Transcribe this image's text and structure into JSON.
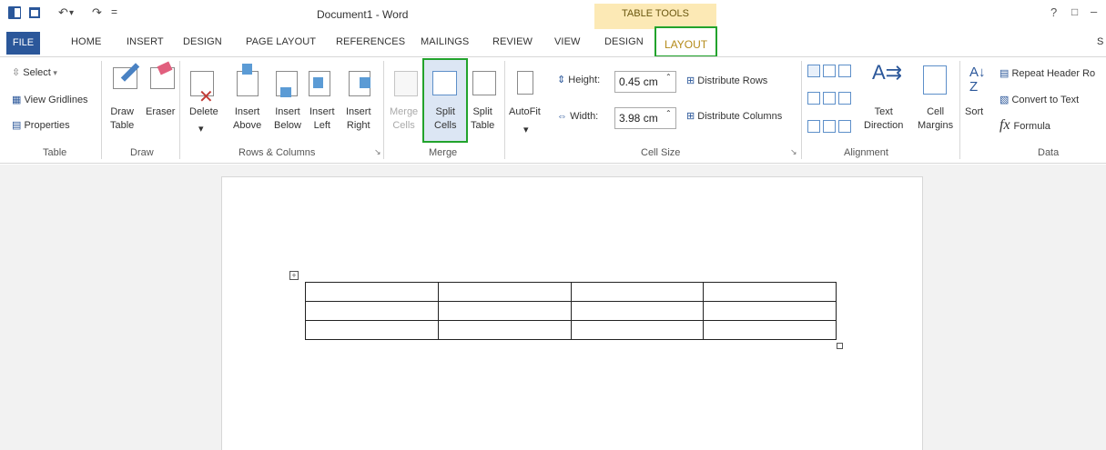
{
  "window": {
    "title": "Document1 - Word",
    "help": "?",
    "restore": "□",
    "minimize": "–"
  },
  "qat": {
    "undo": "↶",
    "redo": "↷",
    "more": "="
  },
  "contextual_group": "TABLE TOOLS",
  "tabs": [
    "FILE",
    "HOME",
    "INSERT",
    "DESIGN",
    "PAGE LAYOUT",
    "REFERENCES",
    "MAILINGS",
    "REVIEW",
    "VIEW",
    "DESIGN",
    "LAYOUT",
    "S"
  ],
  "groups": {
    "table": {
      "label": "Table",
      "select": "Select",
      "gridlines": "View Gridlines",
      "properties": "Properties"
    },
    "draw": {
      "label": "Draw",
      "draw_table": "Draw\nTable",
      "eraser": "Eraser"
    },
    "rows": {
      "label": "Rows & Columns",
      "delete": "Delete",
      "above": "Insert\nAbove",
      "below": "Insert\nBelow",
      "left": "Insert\nLeft",
      "right": "Insert\nRight"
    },
    "merge": {
      "label": "Merge",
      "merge": "Merge\nCells",
      "split_cells": "Split\nCells",
      "split_table": "Split\nTable"
    },
    "cellsize": {
      "label": "Cell Size",
      "autofit": "AutoFit",
      "height_label": "Height:",
      "height": "0.45 cm",
      "width_label": "Width:",
      "width": "3.98 cm",
      "rows": "Distribute Rows",
      "cols": "Distribute Columns"
    },
    "alignment": {
      "label": "Alignment",
      "text_dir": "Text\nDirection",
      "margins": "Cell\nMargins"
    },
    "data": {
      "label": "Data",
      "sort": "Sort",
      "repeat": "Repeat Header Ro",
      "convert": "Convert to Text",
      "formula": "Formula"
    }
  },
  "document": {
    "rows": 3,
    "cols": 4
  }
}
